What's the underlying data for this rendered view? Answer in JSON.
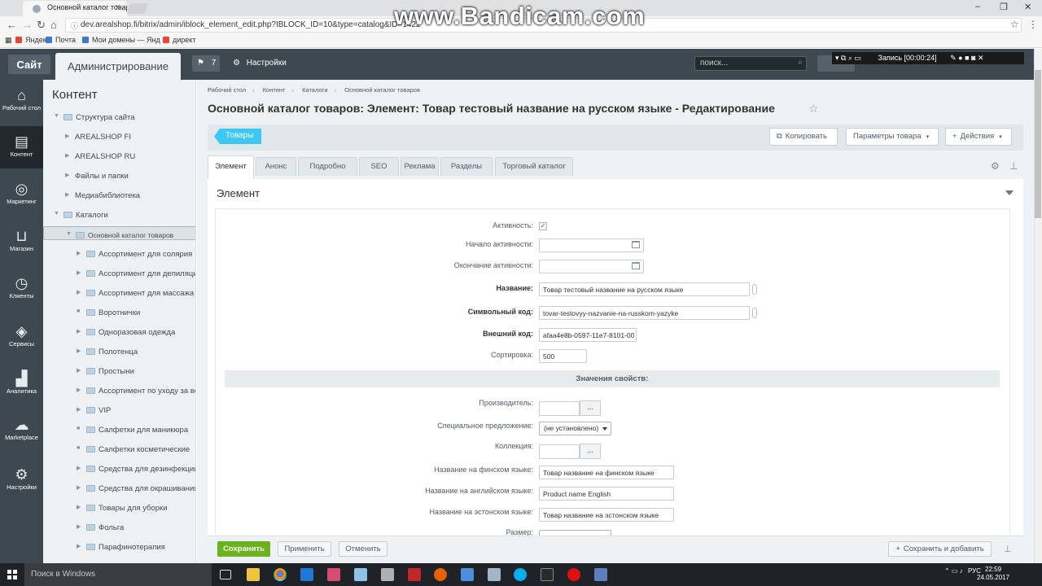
{
  "browser": {
    "tabs": [
      {
        "title": "Основной каталог товар"
      },
      {
        "title": ""
      }
    ],
    "url": "dev.arealshop.fi/bitrix/admin/iblock_element_edit.php?IBLOCK_ID=10&type=catalog&ID=1422",
    "bookmarks": [
      {
        "label": "Яндекс",
        "color": "#e43"
      },
      {
        "label": "Почта",
        "color": "#3a7bd5"
      },
      {
        "label": "Мои домены — Янд",
        "color": "#3a7bd5"
      },
      {
        "label": "директ",
        "color": "#e43"
      }
    ]
  },
  "watermark": "www.Bandicam.com",
  "recorder": {
    "text": "Запись [00:00:24]"
  },
  "admin_panel": {
    "site_label": "Сайт",
    "admin_label": "Администрирование",
    "notifications": "7",
    "settings_label": "Настройки",
    "search_placeholder": "поиск..."
  },
  "left_menu": [
    {
      "label": "Рабочий стол",
      "icon": "home-icon",
      "glyph": "⌂"
    },
    {
      "label": "Контент",
      "icon": "document-icon",
      "glyph": "▤",
      "active": true
    },
    {
      "label": "Маркетинг",
      "icon": "target-icon",
      "glyph": "◎"
    },
    {
      "label": "Магазин",
      "icon": "cart-icon",
      "glyph": "⊔"
    },
    {
      "label": "Клиенты",
      "icon": "clients-icon",
      "glyph": "◷"
    },
    {
      "label": "Сервисы",
      "icon": "layers-icon",
      "glyph": "◈"
    },
    {
      "label": "Аналитика",
      "icon": "bar-chart-icon",
      "glyph": "▟"
    },
    {
      "label": "Marketplace",
      "icon": "cloud-icon",
      "glyph": "☁"
    },
    {
      "label": "Настройки",
      "icon": "gear-icon",
      "glyph": "⚙"
    }
  ],
  "tree": {
    "title": "Контент",
    "items": [
      {
        "label": "Структура сайта",
        "level": 0,
        "expanded": true
      },
      {
        "label": "AREALSHOP FI",
        "level": 1
      },
      {
        "label": "AREALSHOP RU",
        "level": 1
      },
      {
        "label": "Файлы и папки",
        "level": 1
      },
      {
        "label": "Медиабиблиотека",
        "level": 1
      },
      {
        "label": "Каталоги",
        "level": 0,
        "expanded": true
      },
      {
        "label": "Основной каталог товаров",
        "level": 1,
        "selected": true,
        "expanded": true
      },
      {
        "label": "Ассортимент для солярия",
        "level": 2
      },
      {
        "label": "Ассортимент для депиляции",
        "level": 2
      },
      {
        "label": "Ассортимент для массажа",
        "level": 2
      },
      {
        "label": "Воротнички",
        "level": 2,
        "leaf": true
      },
      {
        "label": "Одноразовая одежда",
        "level": 2
      },
      {
        "label": "Полотенца",
        "level": 2
      },
      {
        "label": "Простыни",
        "level": 2
      },
      {
        "label": "Ассортимент по уходу за вол",
        "level": 2
      },
      {
        "label": "VIP",
        "level": 2
      },
      {
        "label": "Салфетки для маникюра",
        "level": 2,
        "leaf": true
      },
      {
        "label": "Салфетки косметические",
        "level": 2,
        "leaf": true
      },
      {
        "label": "Средства для дезинфекции",
        "level": 2
      },
      {
        "label": "Средства для окрашивания бр",
        "level": 2
      },
      {
        "label": "Товары для уборки",
        "level": 2
      },
      {
        "label": "Фольга",
        "level": 2
      },
      {
        "label": "Парафинотерапия",
        "level": 2
      }
    ]
  },
  "breadcrumb": [
    "Рабочий стол",
    "Контент",
    "Каталоги",
    "Основной каталог товаров"
  ],
  "page_title": "Основной каталог товаров: Элемент: Товар тестовый название на русском языке - Редактирование",
  "toolbar": {
    "tovary": "Товары",
    "copy": "Копировать",
    "params": "Параметры товара",
    "actions": "Действия"
  },
  "tabs": [
    {
      "label": "Элемент",
      "active": true
    },
    {
      "label": "Анонс"
    },
    {
      "label": "Подробно"
    },
    {
      "label": "SEO"
    },
    {
      "label": "Реклама"
    },
    {
      "label": "Разделы"
    },
    {
      "label": "Торговый каталог"
    }
  ],
  "section_title": "Элемент",
  "form": {
    "active_label": "Активность:",
    "active_checked": true,
    "active_from_label": "Начало активности:",
    "active_from_value": "",
    "active_to_label": "Окончание активности:",
    "active_to_value": "",
    "name_label": "Название:",
    "name_value": "Товар тестовый название на русском языке",
    "code_label": "Символьный код:",
    "code_value": "tovar-testovyy-nazvanie-na-russkom-yazyke",
    "xml_label": "Внешний код:",
    "xml_value": "afaa4e8b-0597-11e7-8101-00",
    "sort_label": "Сортировка:",
    "sort_value": "500",
    "props_title": "Значения свойств:",
    "manufacturer_label": "Производитель:",
    "manufacturer_value": "",
    "special_label": "Специальное предложение:",
    "special_value": "(не установлено)",
    "collection_label": "Коллекция:",
    "collection_value": "",
    "name_fi_label": "Название на финском языке:",
    "name_fi_value": "Товар название на финском языке",
    "name_en_label": "Название на английском языке:",
    "name_en_value": "Product name English",
    "name_et_label": "Название на эстонском языке:",
    "name_et_value": "Товар название на эстонском языке",
    "size_label": "Размер:",
    "dots": "..."
  },
  "bottom": {
    "save": "Сохранить",
    "apply": "Применить",
    "cancel": "Отменить",
    "save_add": "Сохранить и добавить"
  },
  "taskbar": {
    "search_placeholder": "Поиск в Windows",
    "lang": "РУС",
    "time": "22:59",
    "date": "24.05.2017"
  }
}
